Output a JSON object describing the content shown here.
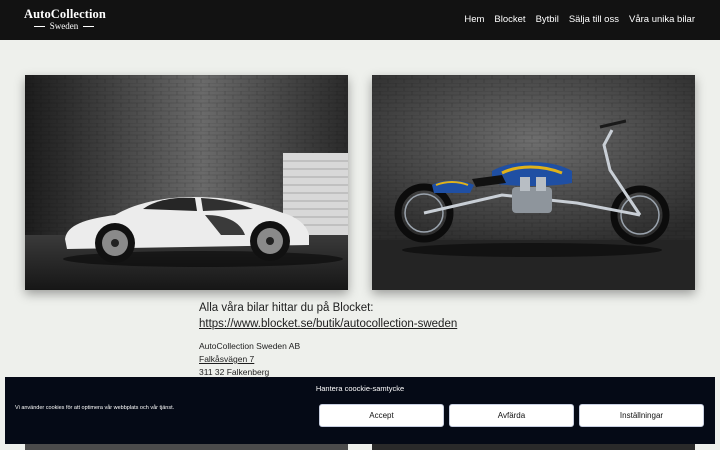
{
  "logo": {
    "title": "AutoCollection",
    "subtitle": "Sweden"
  },
  "nav": {
    "items": [
      "Hem",
      "Blocket",
      "Bytbil",
      "Sälja till oss",
      "Våra unika bilar"
    ]
  },
  "content": {
    "intro_text": "Alla våra bilar hittar du på Blocket:",
    "blocket_link": "https://www.blocket.se/butik/autocollection-sweden",
    "company": "AutoCollection Sweden AB",
    "street": "Falkåsvägen 7",
    "postal": "311 32 Falkenberg"
  },
  "cookie": {
    "title": "Hantera coockie-samtycke",
    "text": "Vi använder cookies för att optimera vår webbplats och vår tjänst.",
    "accept": "Accept",
    "deny": "Avfärda",
    "settings": "Inställningar"
  }
}
